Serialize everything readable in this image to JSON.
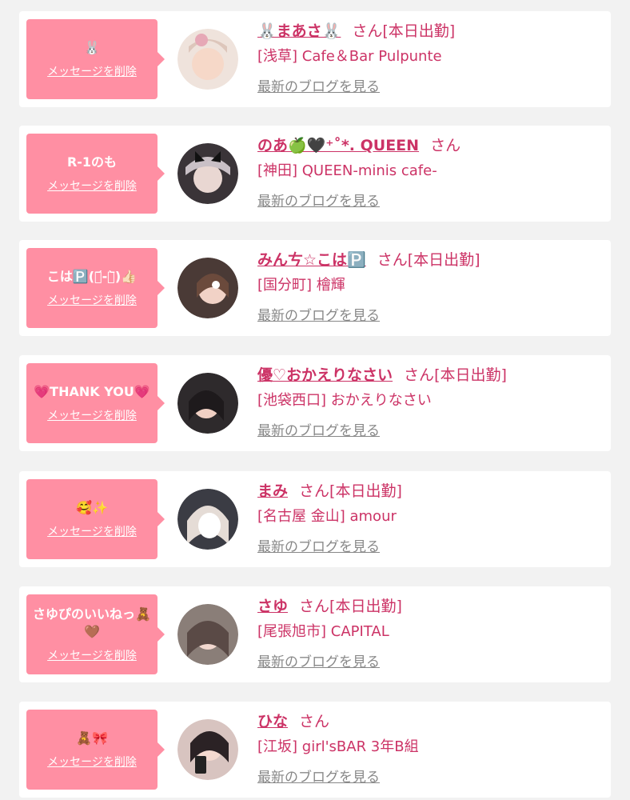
{
  "delete_label": "メッセージを削除",
  "blog_label": "最新のブログを見る",
  "san_label": "さん",
  "colors": {
    "background": "#f2f2f2",
    "bubble": "#ff8fa3",
    "name": "#cc3366",
    "link_gray": "#888888"
  },
  "items": [
    {
      "message": "🐰",
      "name": "🐰まあさ🐰",
      "status": "[本日出勤]",
      "shop": "[浅草] Cafe＆Bar Pulpunte"
    },
    {
      "message": "R-1のも",
      "name": "のあ🍏🖤⁺˚*. QUEEN",
      "status": "",
      "shop": "[神田] QUEEN-minis cafe-"
    },
    {
      "message": "こは🅿️(・᷄-・᷅)👍🏻",
      "name": "みんㄘ☆こは🅿️",
      "status": "[本日出勤]",
      "shop": "[国分町] 檜輝"
    },
    {
      "message": "💗THANK YOU💗",
      "name": "優♡おかえりなさい",
      "status": "[本日出勤]",
      "shop": "[池袋西口] おかえりなさい"
    },
    {
      "message": "🥰✨",
      "name": "まみ",
      "status": "[本日出勤]",
      "shop": "[名古屋 金山] amour"
    },
    {
      "message": "さゆぴのいいねっ🧸🤎",
      "name": "さゆ",
      "status": "[本日出勤]",
      "shop": "[尾張旭市] CAPITAL"
    },
    {
      "message": "🧸🎀",
      "name": "ひな",
      "status": "",
      "shop": "[江坂] girl'sBAR 3年B組"
    }
  ]
}
